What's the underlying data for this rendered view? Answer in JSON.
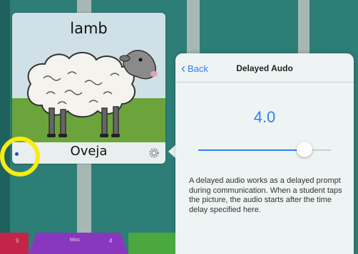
{
  "card": {
    "title": "lamb",
    "caption": "Oveja",
    "settings_icon": "gear-icon",
    "image": "sheep-illustration"
  },
  "popover": {
    "back_label": "Back",
    "title": "Delayed Audo",
    "value": "4.0",
    "slider_fraction": 0.8,
    "description": "A delayed audio works as a delayed prompt during communication. When a student taps the picture, the audio starts after the time delay specified here."
  },
  "tabs": {
    "left_number": "9",
    "middle_label": "Misc",
    "right_number": "4"
  },
  "colors": {
    "background": "#2e7e78",
    "accent": "#2f7ef6",
    "highlight": "#f6ec12"
  }
}
